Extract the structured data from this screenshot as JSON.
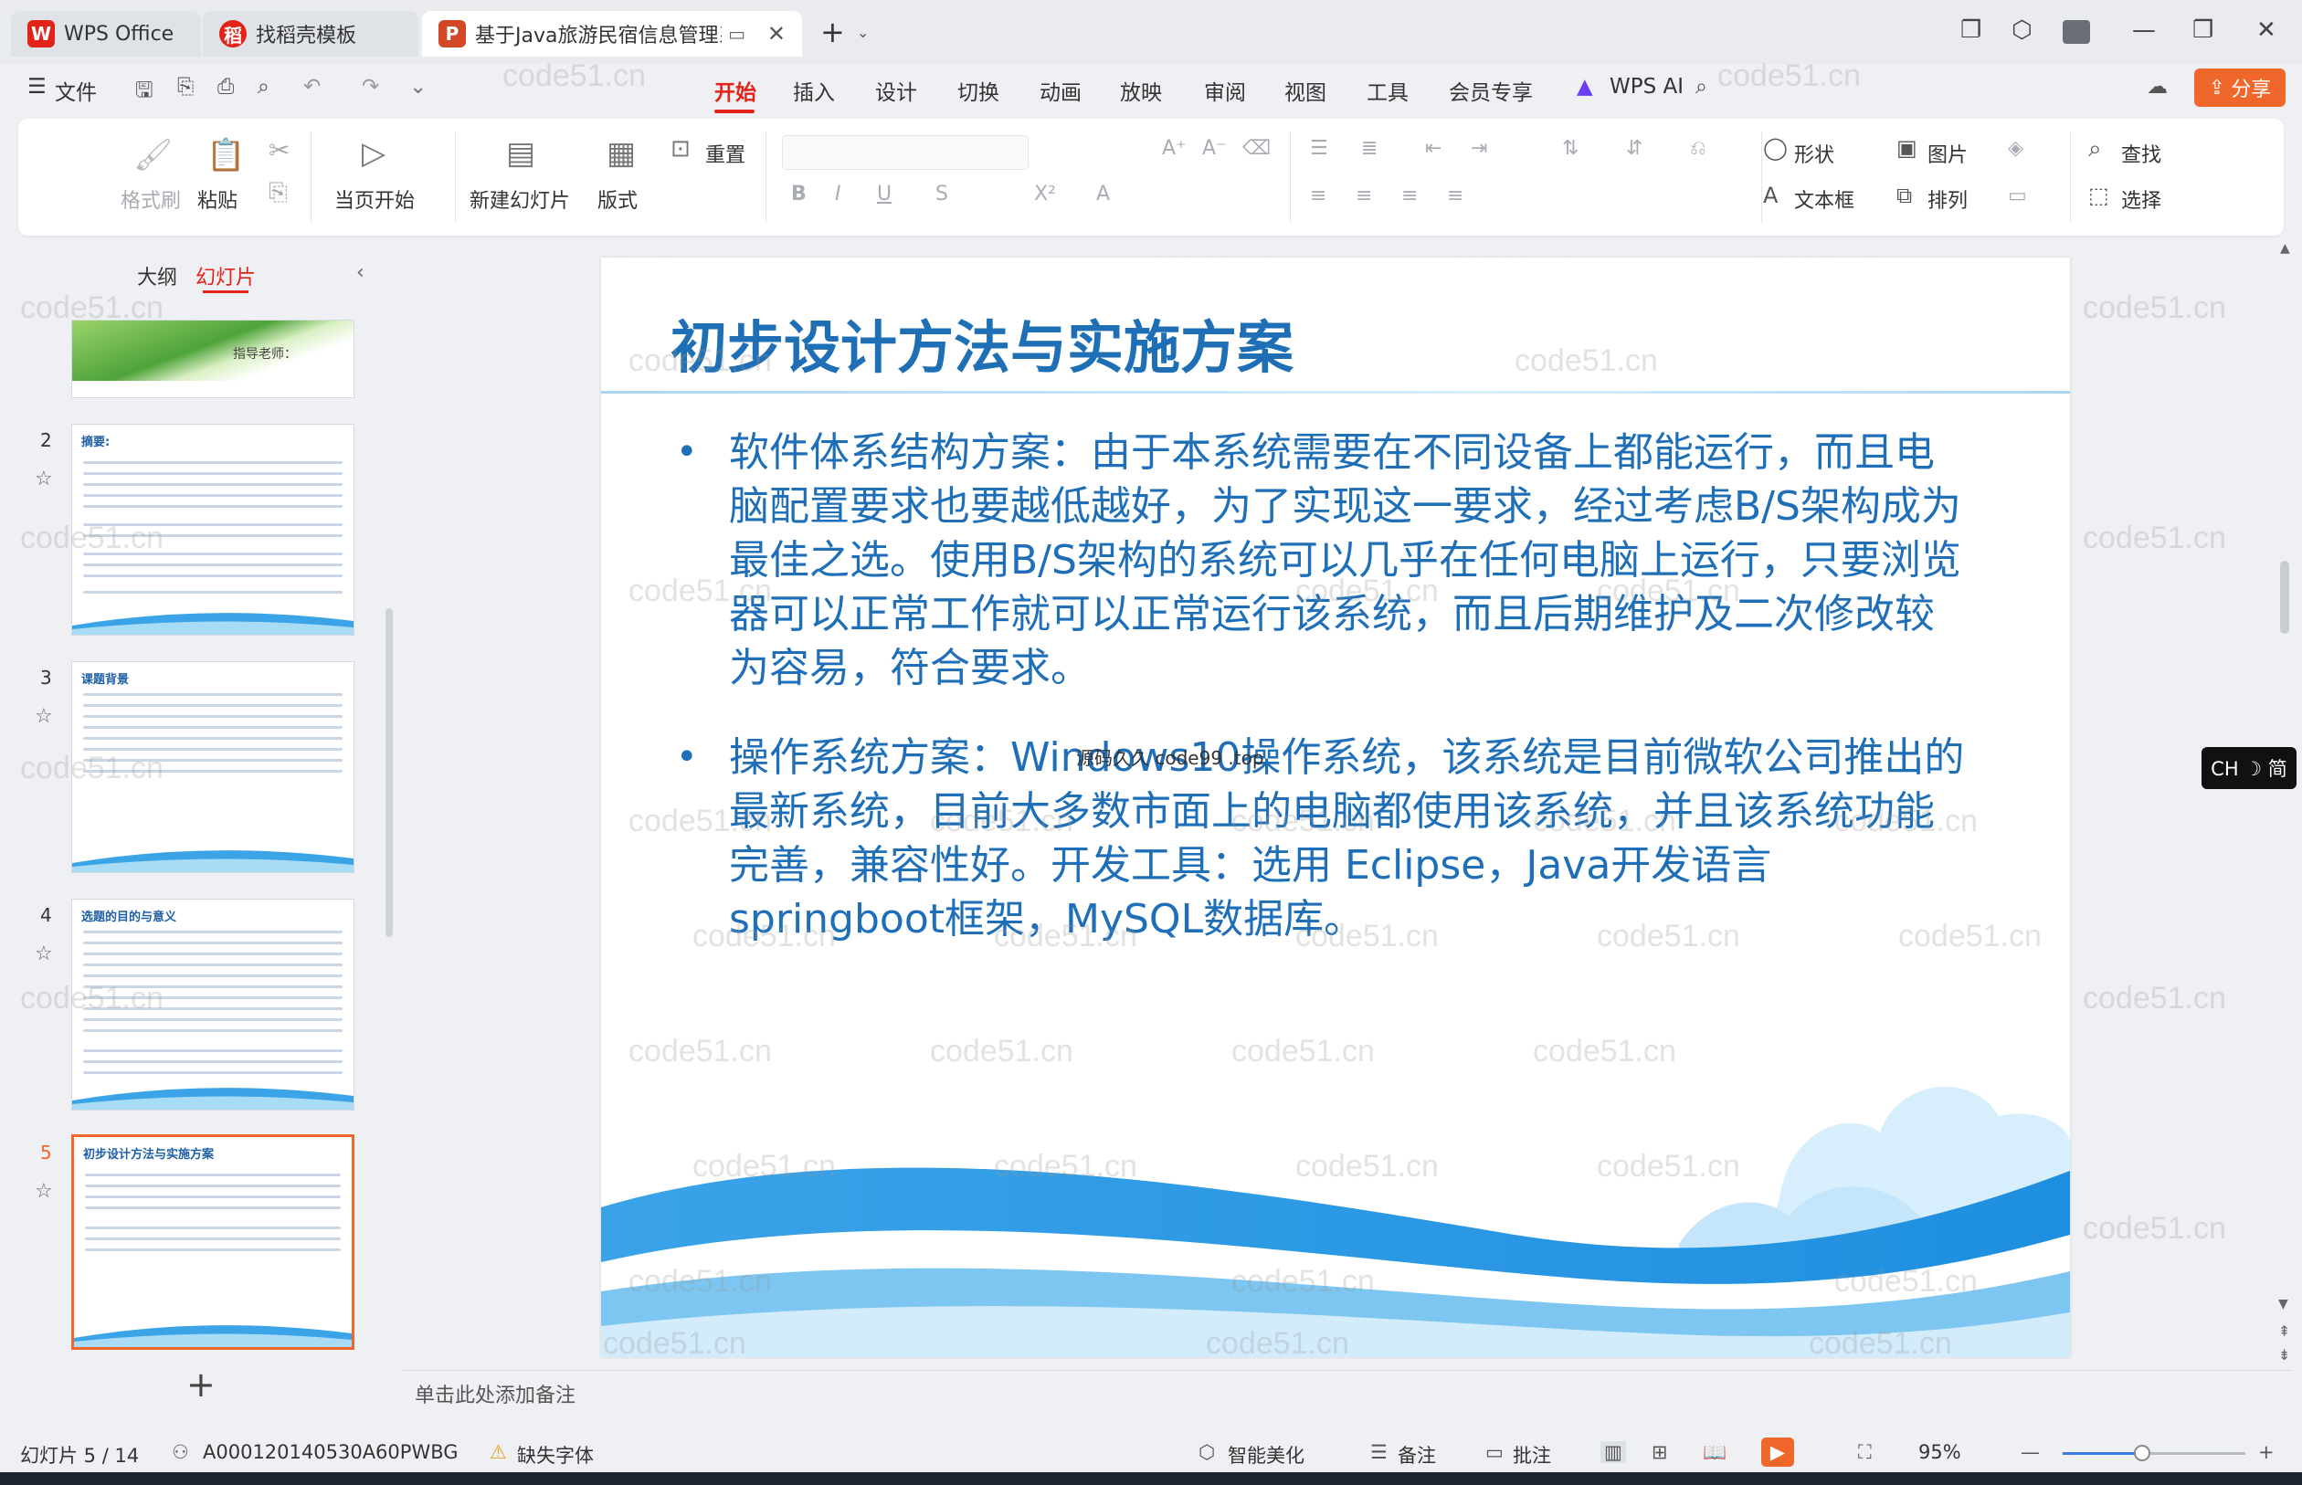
{
  "titlebar": {
    "tabs": [
      {
        "label": "WPS Office"
      },
      {
        "label": "找稻壳模板"
      },
      {
        "label": "基于Java旅游民宿信息管理系"
      }
    ]
  },
  "menubar": {
    "file": "文件",
    "items": [
      "开始",
      "插入",
      "设计",
      "切换",
      "动画",
      "放映",
      "审阅",
      "视图",
      "工具",
      "会员专享",
      "WPS AI"
    ],
    "share": "分享"
  },
  "ribbon": {
    "format_painter": "格式刷",
    "paste": "粘贴",
    "play_current": "当页开始",
    "new_slide": "新建幻灯片",
    "layout": "版式",
    "reset": "重置",
    "shape": "形状",
    "picture": "图片",
    "find": "查找",
    "textbox": "文本框",
    "arrange": "排列",
    "select": "选择"
  },
  "leftpanel": {
    "outline_tab": "大纲",
    "slides_tab": "幻灯片",
    "add": "+",
    "thumb1_text": "指导老师：",
    "thumbs": [
      {
        "num": "2",
        "title": "摘要:"
      },
      {
        "num": "3",
        "title": "课题背景"
      },
      {
        "num": "4",
        "title": "选题的目的与意义"
      },
      {
        "num": "5",
        "title": "初步设计方法与实施方案"
      }
    ]
  },
  "slide": {
    "title": "初步设计方法与实施方案",
    "bullets": [
      "软件体系结构方案：由于本系统需要在不同设备上都能运行，而且电脑配置要求也要越低越好，为了实现这一要求，经过考虑B/S架构成为最佳之选。使用B/S架构的系统可以几乎在任何电脑上运行，只要浏览器可以正常工作就可以正常运行该系统，而且后期维护及二次修改较为容易，符合要求。",
      "操作系统方案：Windows10操作系统，该系统是目前微软公司推出的最新系统，目前大多数市面上的电脑都使用该系统，并且该系统功能完善，兼容性好。开发工具：选用 Eclipse，Java开发语言springboot框架，MySQL数据库。"
    ],
    "inline_watermark": "源码久久 code99 .top",
    "watermark": "code51.cn"
  },
  "notes": "单击此处添加备注",
  "statusbar": {
    "slide_pos": "幻灯片 5 / 14",
    "doc_id": "A000120140530A60PWBG",
    "missing_font": "缺失字体",
    "beautify": "智能美化",
    "notes": "备注",
    "comment": "批注",
    "zoom": "95%"
  },
  "ime": "CH ☽ 简",
  "colors": {
    "accent": "#e2231a",
    "share": "#f0672b",
    "slide_text": "#1f6fb8"
  }
}
